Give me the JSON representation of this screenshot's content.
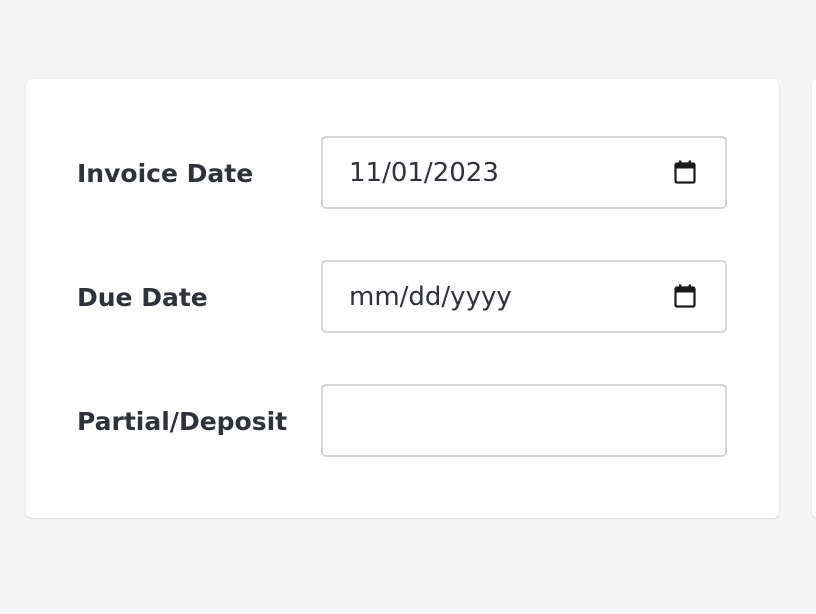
{
  "form": {
    "fields": [
      {
        "label": "Invoice Date",
        "value": "11/01/2023",
        "icon": "calendar-icon"
      },
      {
        "label": "Due Date",
        "value": "mm/dd/yyyy",
        "icon": "calendar-icon"
      },
      {
        "label": "Partial/Deposit",
        "value": ""
      }
    ]
  },
  "colors": {
    "background": "#f5f5f6",
    "card": "#ffffff",
    "text": "#2f3339",
    "border": "#d3d5d9"
  }
}
